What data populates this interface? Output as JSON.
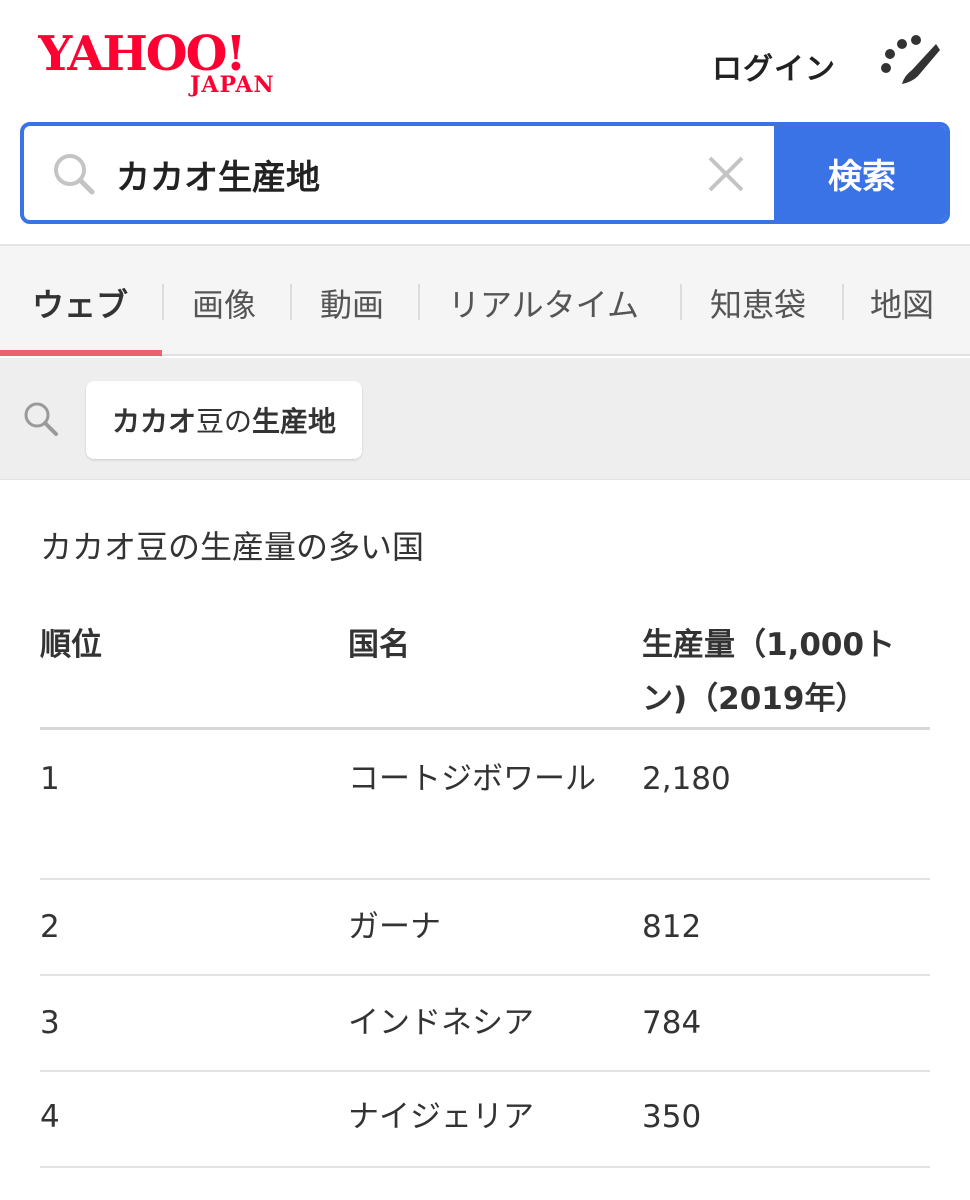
{
  "header": {
    "logo_main": "YAHOO!",
    "logo_sub": "JAPAN",
    "login_label": "ログイン",
    "theme_icon": "paint-brush-icon",
    "brand_color": "#ff0033"
  },
  "search": {
    "value": "カカオ生産地",
    "button_label": "検索",
    "accent_color": "#3a73e6"
  },
  "tabs": [
    {
      "label": "ウェブ",
      "active": true
    },
    {
      "label": "画像"
    },
    {
      "label": "動画"
    },
    {
      "label": "リアルタイム"
    },
    {
      "label": "知恵袋"
    },
    {
      "label": "地図"
    }
  ],
  "related": {
    "bold_1": "カカオ",
    "normal": "豆の",
    "bold_2": "生産地"
  },
  "content": {
    "title": "カカオ豆の生産量の多い国",
    "headers": [
      "順位",
      "国名",
      "生産量（1,000トン)（2019年）"
    ],
    "rows": [
      [
        "1",
        "コートジボワール",
        "2,180"
      ],
      [
        "2",
        "ガーナ",
        "812"
      ],
      [
        "3",
        "インドネシア",
        "784"
      ],
      [
        "4",
        "ナイジェリア",
        "350"
      ]
    ]
  }
}
